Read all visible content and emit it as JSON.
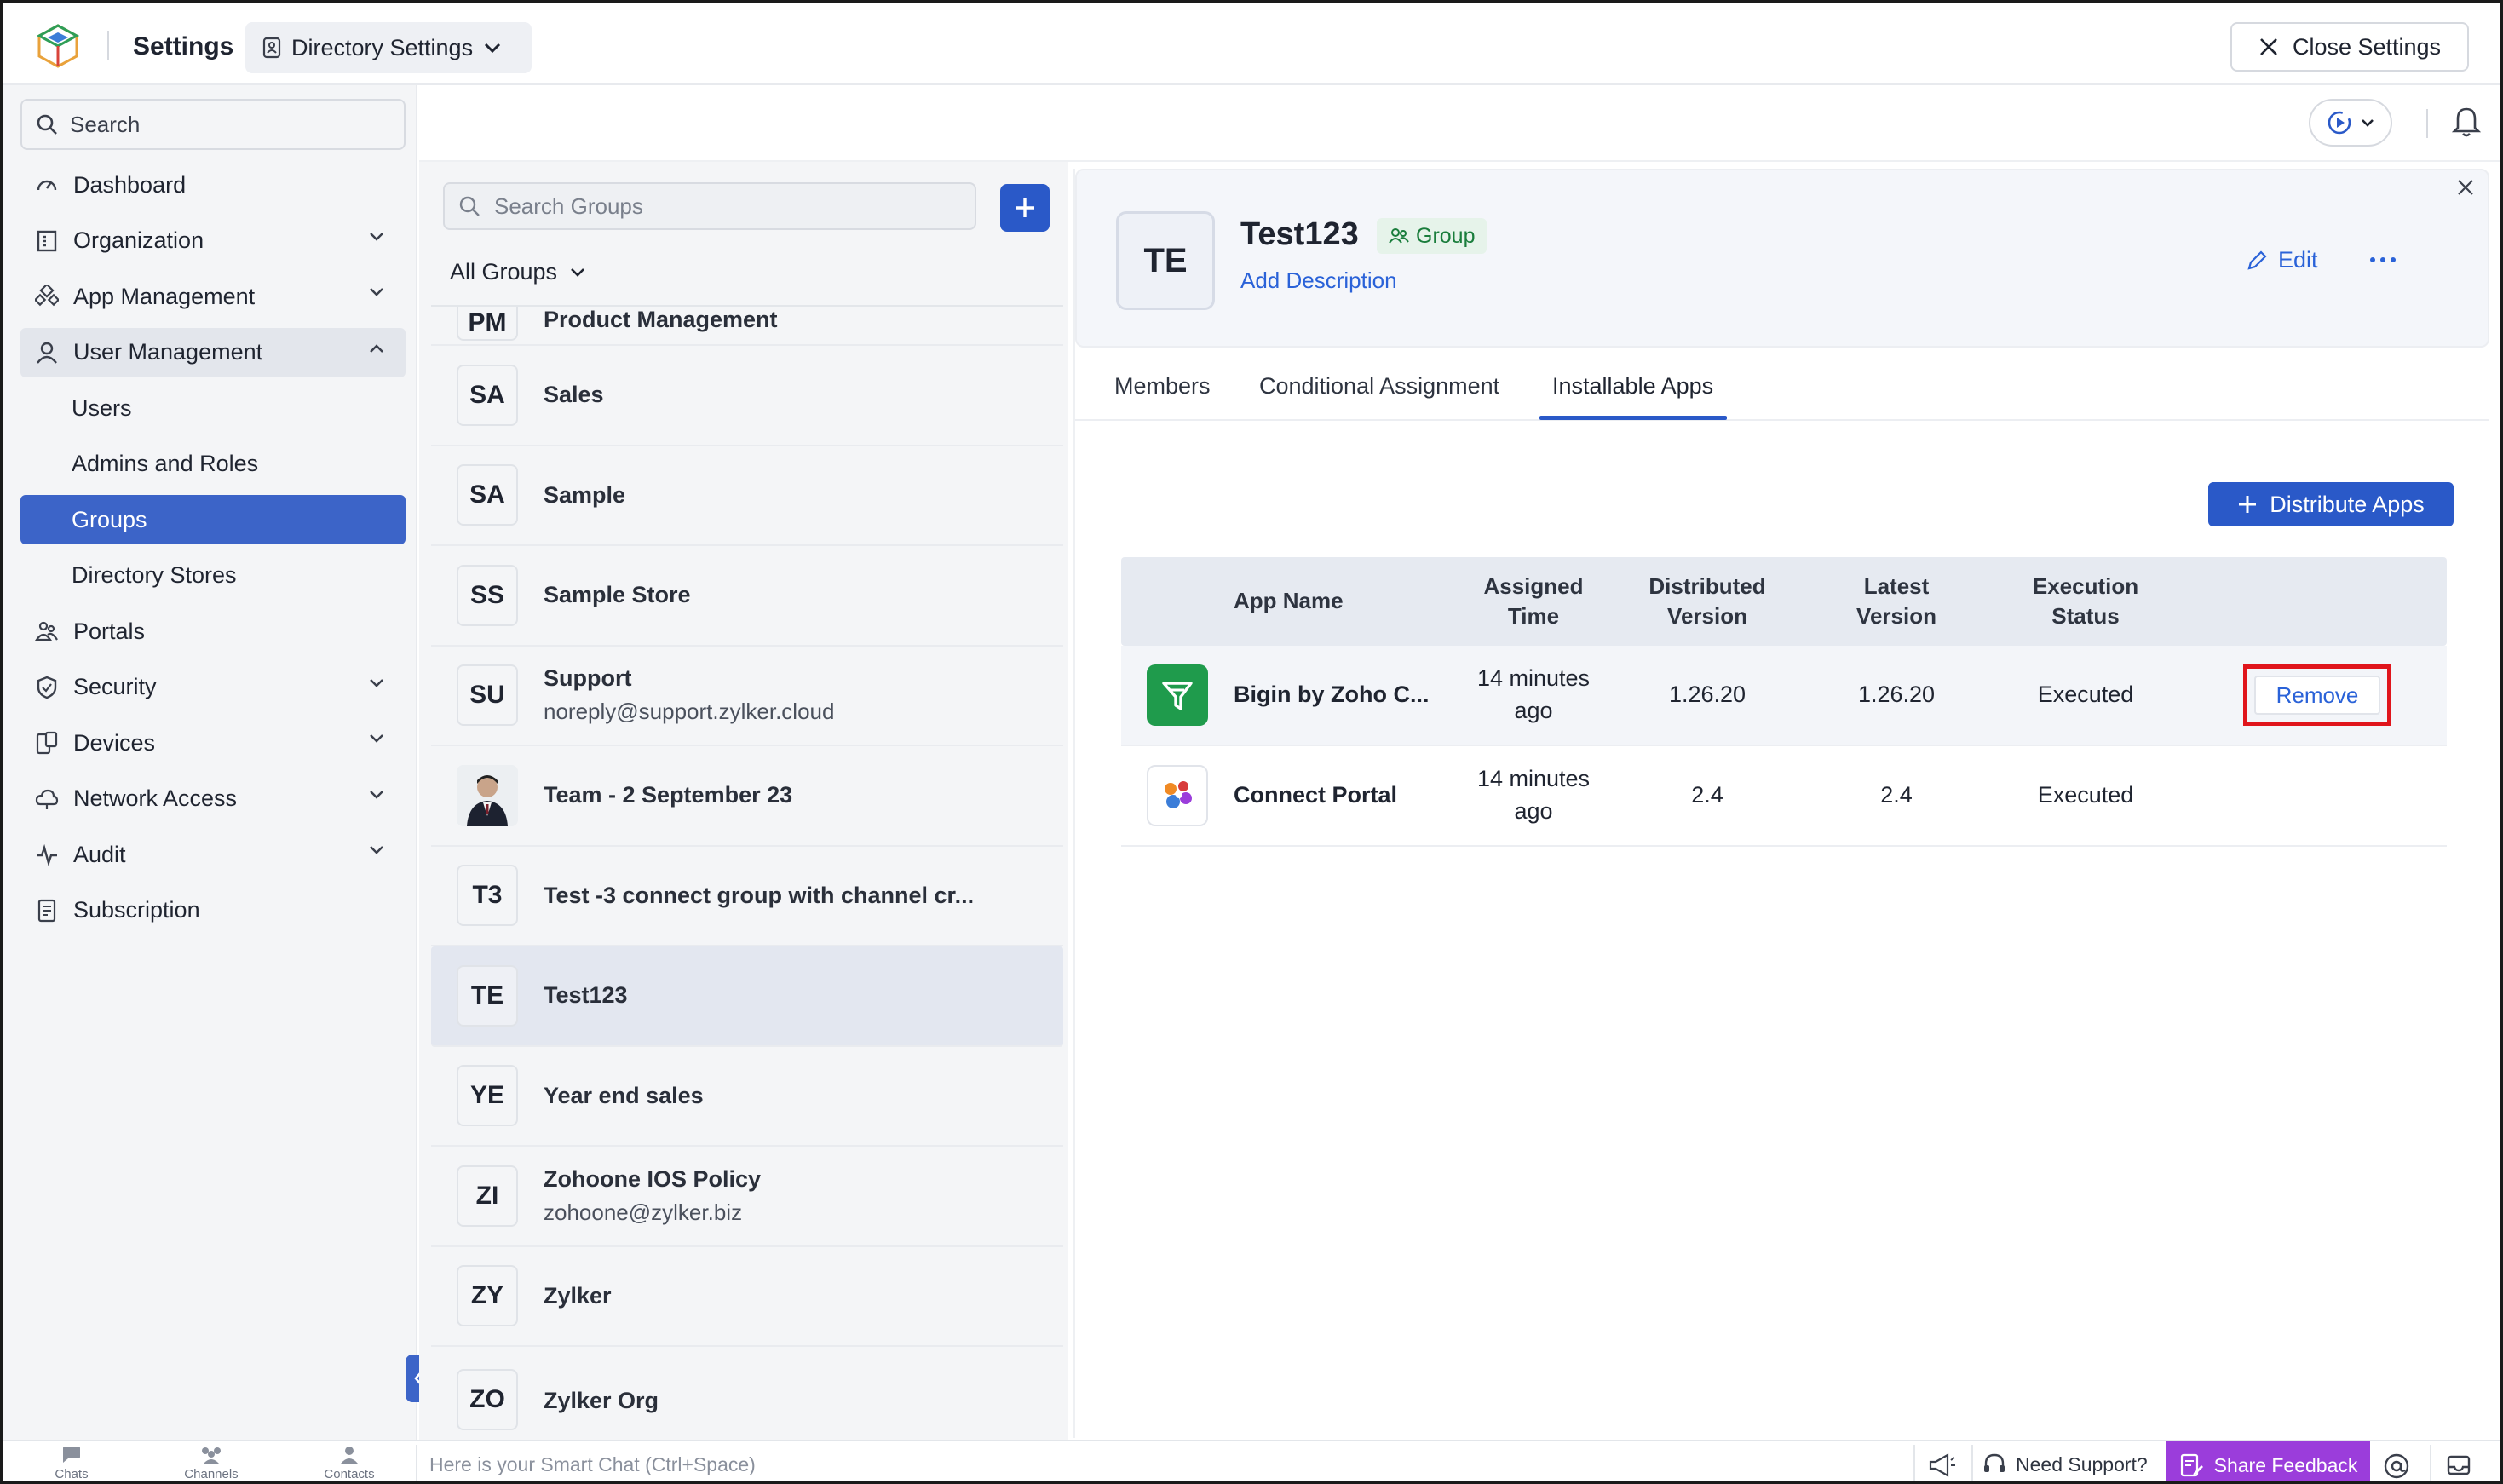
{
  "header": {
    "app_title": "Settings",
    "directory_dropdown": "Directory Settings",
    "close_label": "Close Settings"
  },
  "sidebar": {
    "search_placeholder": "Search",
    "items": [
      {
        "label": "Dashboard",
        "icon": "gauge-icon"
      },
      {
        "label": "Organization",
        "icon": "building-icon",
        "expandable": true
      },
      {
        "label": "App Management",
        "icon": "apps-icon",
        "expandable": true
      },
      {
        "label": "User Management",
        "icon": "user-icon",
        "expandable": true,
        "expanded": true
      },
      {
        "label": "Users",
        "sub": true
      },
      {
        "label": "Admins and Roles",
        "sub": true
      },
      {
        "label": "Groups",
        "sub": true,
        "active": true
      },
      {
        "label": "Directory Stores",
        "sub": true
      },
      {
        "label": "Portals",
        "icon": "portal-icon"
      },
      {
        "label": "Security",
        "icon": "shield-icon",
        "expandable": true
      },
      {
        "label": "Devices",
        "icon": "device-icon",
        "expandable": true
      },
      {
        "label": "Network Access",
        "icon": "network-icon",
        "expandable": true
      },
      {
        "label": "Audit",
        "icon": "pulse-icon",
        "expandable": true
      },
      {
        "label": "Subscription",
        "icon": "receipt-icon"
      }
    ]
  },
  "groups": {
    "search_placeholder": "Search Groups",
    "filter_label": "All Groups",
    "list": [
      {
        "initials": "PM",
        "name": "Product Management",
        "email": ""
      },
      {
        "initials": "SA",
        "name": "Sales",
        "email": ""
      },
      {
        "initials": "SA",
        "name": "Sample",
        "email": ""
      },
      {
        "initials": "SS",
        "name": "Sample Store",
        "email": ""
      },
      {
        "initials": "SU",
        "name": "Support",
        "email": "noreply@support.zylker.cloud"
      },
      {
        "initials": "",
        "name": "Team - 2 September 23",
        "email": "",
        "photo": true
      },
      {
        "initials": "T3",
        "name": "Test -3 connect group with channel cr...",
        "email": ""
      },
      {
        "initials": "TE",
        "name": "Test123",
        "email": "",
        "selected": true
      },
      {
        "initials": "YE",
        "name": "Year end sales",
        "email": ""
      },
      {
        "initials": "ZI",
        "name": "Zohoone IOS Policy",
        "email": "zohoone@zylker.biz"
      },
      {
        "initials": "ZY",
        "name": "Zylker",
        "email": ""
      },
      {
        "initials": "ZO",
        "name": "Zylker Org",
        "email": ""
      }
    ]
  },
  "detail": {
    "initials": "TE",
    "title": "Test123",
    "badge": "Group",
    "add_description": "Add Description",
    "edit_label": "Edit",
    "tabs": [
      "Members",
      "Conditional Assignment",
      "Installable Apps"
    ],
    "active_tab": "Installable Apps",
    "distribute_label": "Distribute Apps",
    "table": {
      "headers": {
        "app_name": "App Name",
        "assigned_1": "Assigned",
        "assigned_2": "Time",
        "distributed_1": "Distributed",
        "distributed_2": "Version",
        "latest_1": "Latest",
        "latest_2": "Version",
        "execution_1": "Execution",
        "execution_2": "Status"
      },
      "rows": [
        {
          "icon": "bigin-icon",
          "name": "Bigin by Zoho C...",
          "time_1": "14 minutes",
          "time_2": "ago",
          "distributed": "1.26.20",
          "latest": "1.26.20",
          "status": "Executed",
          "action": "Remove"
        },
        {
          "icon": "connect-portal-icon",
          "name": "Connect Portal",
          "time_1": "14 minutes",
          "time_2": "ago",
          "distributed": "2.4",
          "latest": "2.4",
          "status": "Executed",
          "action": ""
        }
      ]
    }
  },
  "bottombar": {
    "chats": "Chats",
    "channels": "Channels",
    "contacts": "Contacts",
    "smart_chat_placeholder": "Here is your Smart Chat (Ctrl+Space)",
    "need_support": "Need Support?",
    "share_feedback": "Share Feedback"
  },
  "colors": {
    "accent": "#2a59c8",
    "active_nav": "#3c64c8",
    "link": "#2a62d8",
    "badge_green": "#1a7d3c",
    "highlight_red": "#e0151c",
    "feedback_purple": "#9b3ddb"
  }
}
